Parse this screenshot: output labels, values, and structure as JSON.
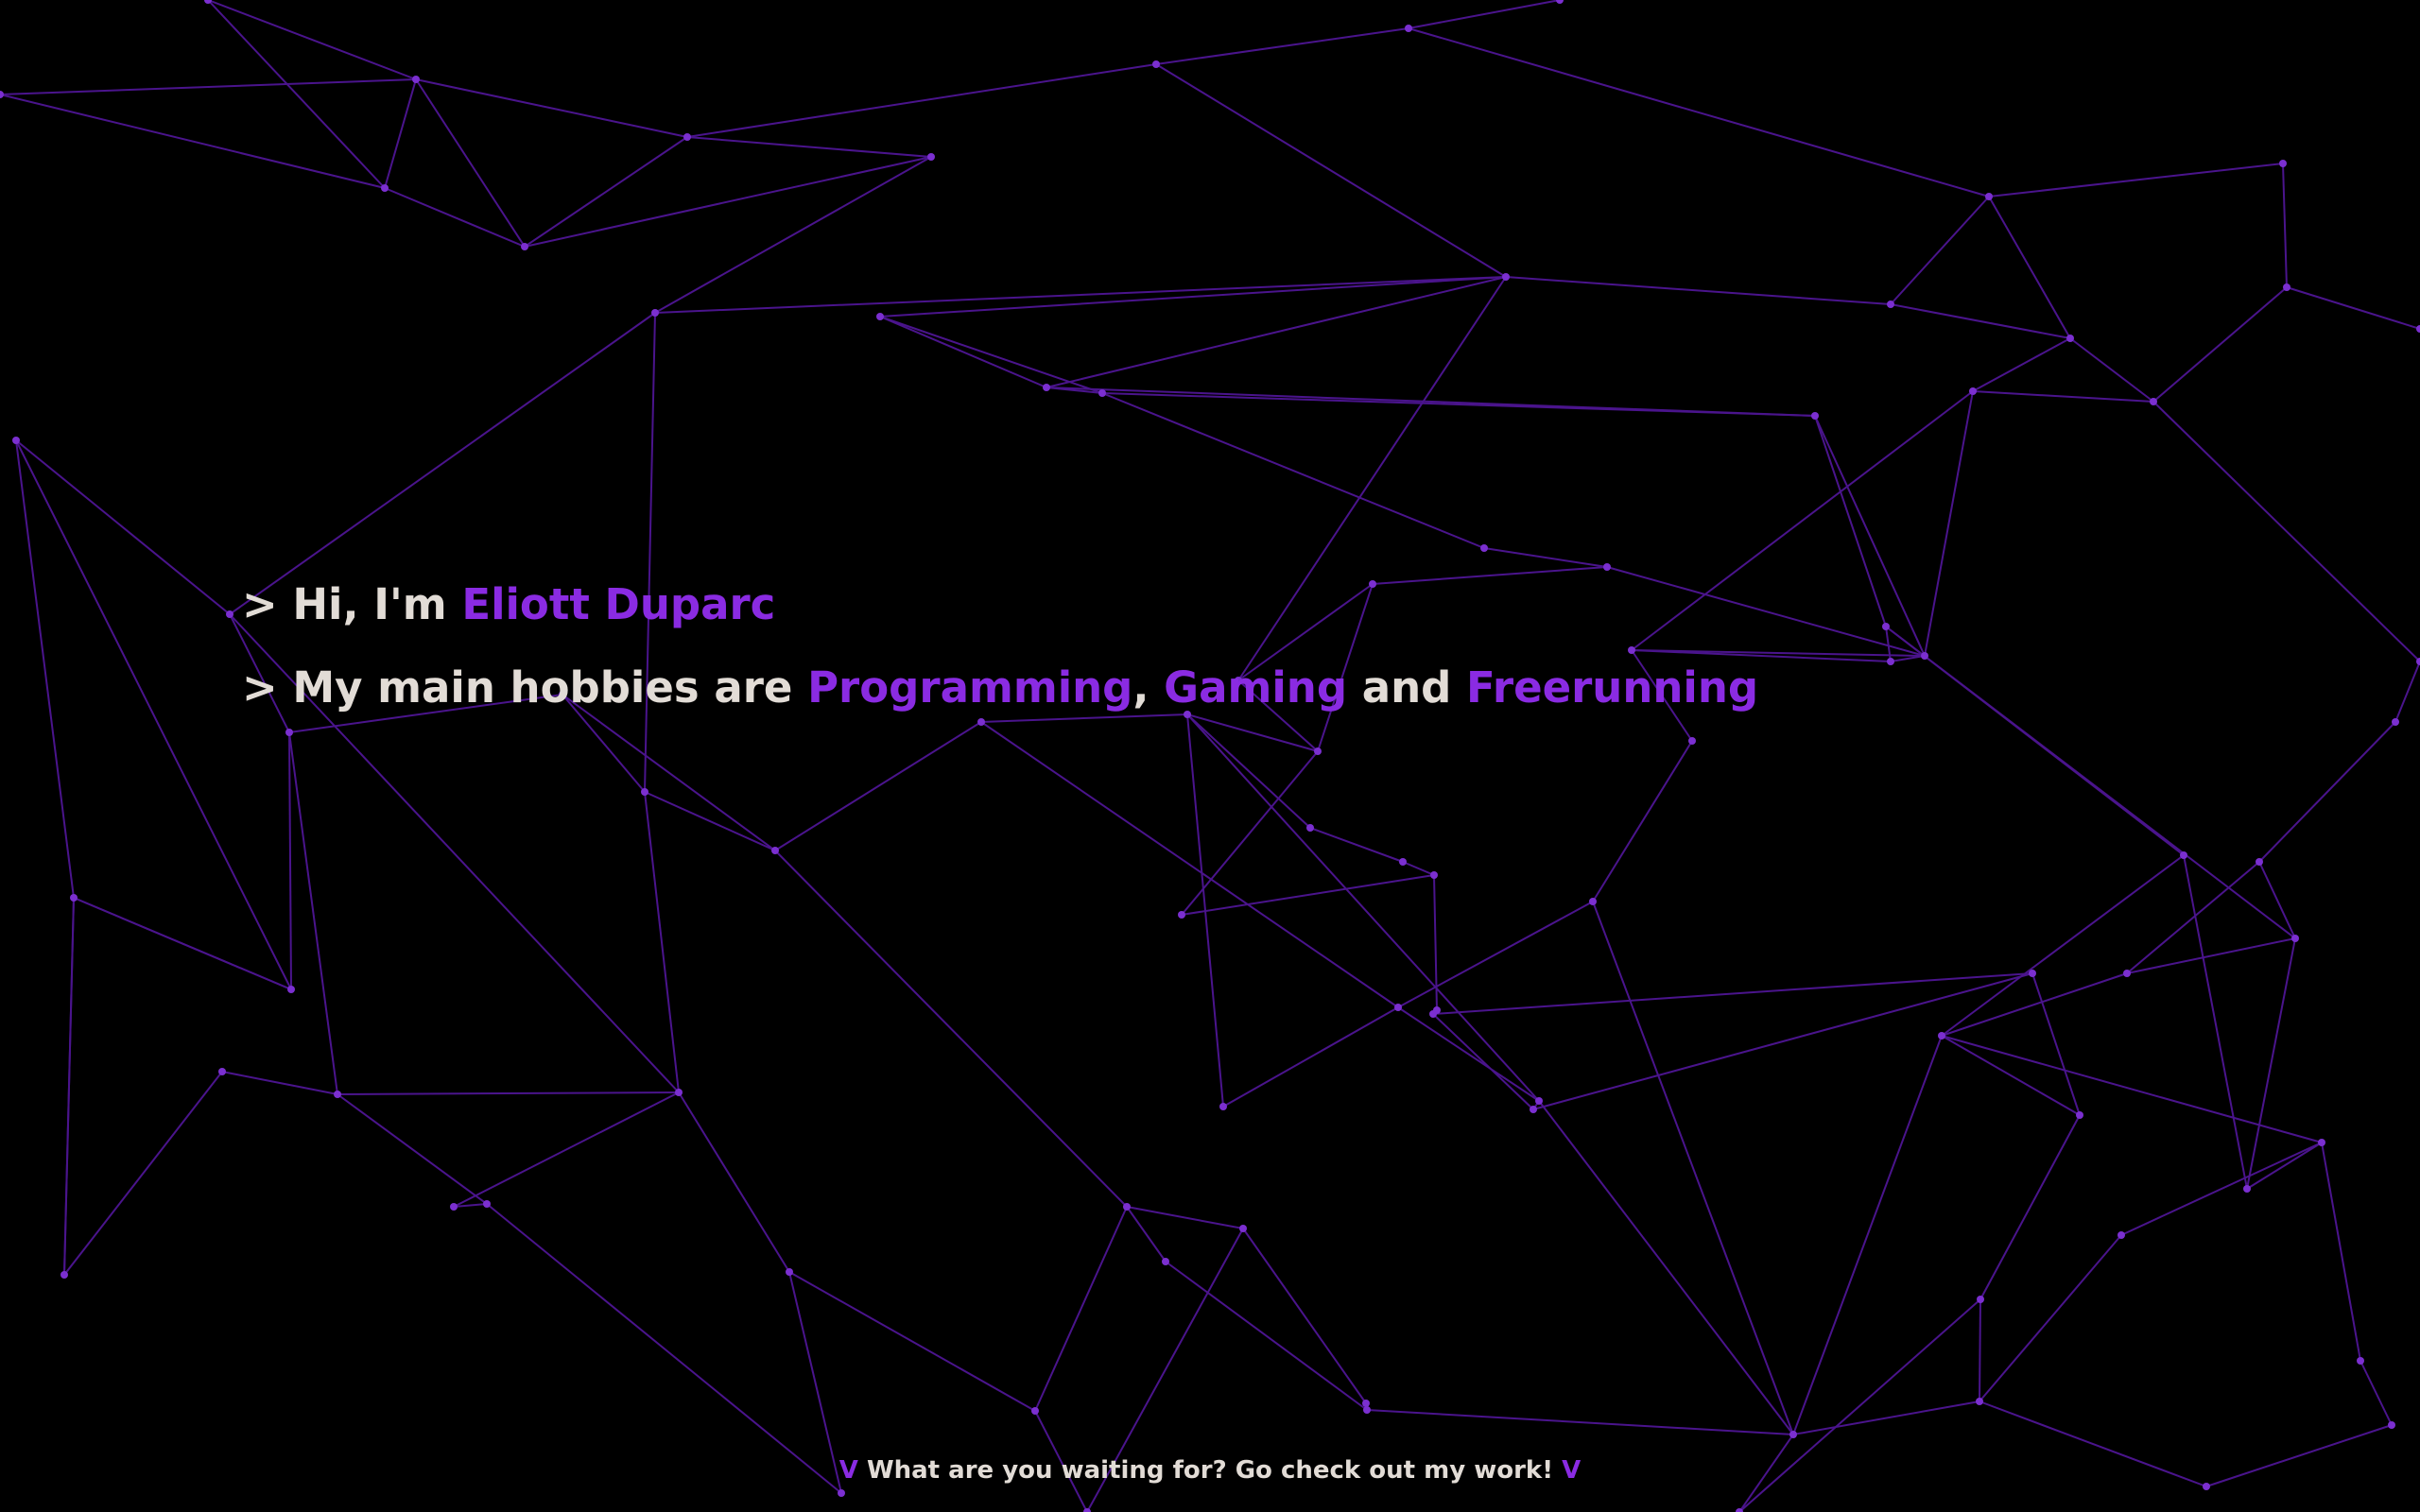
{
  "theme": {
    "background": "#000000",
    "text": "#e2dcd6",
    "accent": "#8a2be2",
    "network_line": "#4a148c",
    "network_node": "#7b2fd0"
  },
  "intro": {
    "line1": {
      "prompt": ">",
      "greeting": "Hi, I'm",
      "name": "Eliott Duparc"
    },
    "line2": {
      "prompt": ">",
      "lead": "My main hobbies are",
      "hobby1": "Programming",
      "separator": ",",
      "hobby2": "Gaming",
      "conjunction": "and",
      "hobby3": "Freerunning"
    }
  },
  "cta": {
    "left_chevron": "V",
    "text": "What are you waiting for? Go check out my work!",
    "right_chevron": "V"
  }
}
